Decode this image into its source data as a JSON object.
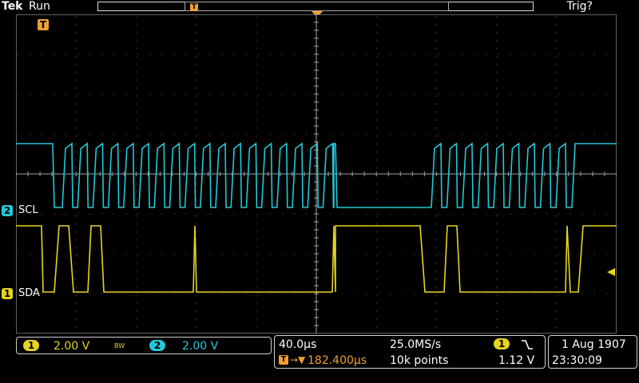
{
  "header": {
    "brand": "Tek",
    "acq_state": "Run",
    "trigger_status": "Trig?"
  },
  "display": {
    "trigger_marker": "T",
    "colors": {
      "ch1": "#e6d420",
      "ch2": "#22c8d8",
      "trigger": "#f0a030",
      "grid": "#606060",
      "center_axis": "#a0a0a0"
    }
  },
  "channels": {
    "ch1": {
      "number": "1",
      "label": "SDA",
      "scale": "2.00 V"
    },
    "ch2": {
      "number": "2",
      "label": "SCL",
      "scale": "2.00 V"
    }
  },
  "settings": {
    "bw_limit": "BW",
    "timebase": "40.0µs",
    "trigger_position": "182.400µs",
    "sample_rate": "25.0MS/s",
    "record_length": "10k points",
    "trigger_source": "1",
    "trigger_slope": "falling-edge-icon",
    "trigger_level": "1.12 V",
    "date": "1 Aug 1907",
    "time": "23:30:09"
  }
}
